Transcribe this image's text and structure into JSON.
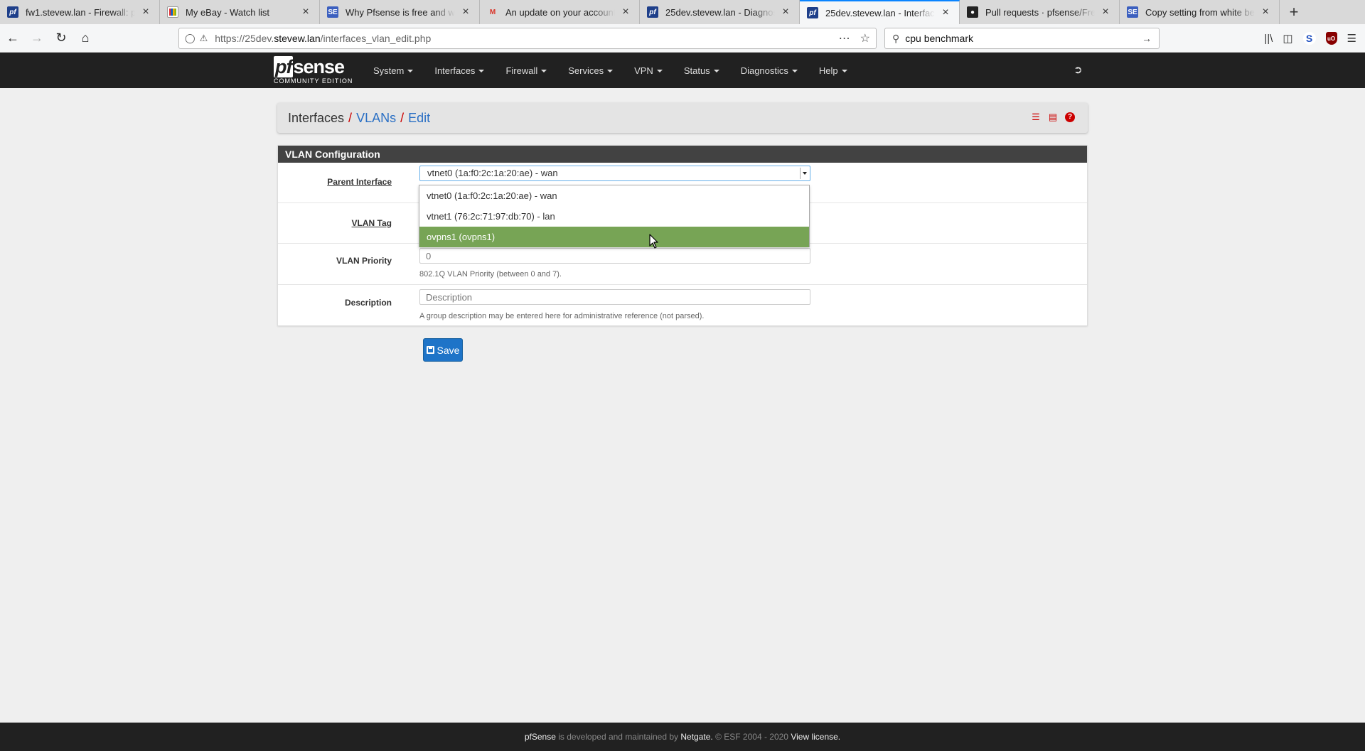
{
  "browser": {
    "tabs": [
      {
        "title": "fw1.stevew.lan - Firewall: p",
        "favicon": "pfsense-icon",
        "active": false
      },
      {
        "title": "My eBay - Watch list",
        "favicon": "ebay-icon",
        "active": false
      },
      {
        "title": "Why Pfsense is free and wh",
        "favicon": "stackexchange-icon",
        "active": false
      },
      {
        "title": "An update on your account",
        "favicon": "gmail-icon",
        "active": false
      },
      {
        "title": "25dev.stevew.lan - Diagnos",
        "favicon": "pfsense-icon",
        "active": false
      },
      {
        "title": "25dev.stevew.lan - Interfac",
        "favicon": "pfsense-icon",
        "active": true
      },
      {
        "title": "Pull requests · pfsense/Fre",
        "favicon": "github-icon",
        "active": false
      },
      {
        "title": "Copy setting from white be",
        "favicon": "stackexchange-icon",
        "active": false
      }
    ],
    "url_prefix": "https://25dev.",
    "url_domain": "stevew.lan",
    "url_path": "/interfaces_vlan_edit.php",
    "search_value": "cpu benchmark"
  },
  "pfsense": {
    "logo_text": "sense",
    "logo_pf": "pf",
    "edition": "COMMUNITY EDITION",
    "menu": [
      "System",
      "Interfaces",
      "Firewall",
      "Services",
      "VPN",
      "Status",
      "Diagnostics",
      "Help"
    ]
  },
  "breadcrumb": {
    "root": "Interfaces",
    "level2": "VLANs",
    "level3": "Edit",
    "separator": "/"
  },
  "panel": {
    "title": "VLAN Configuration",
    "parent_interface_label": "Parent Interface",
    "parent_interface_value": "vtnet0 (1a:f0:2c:1a:20:ae) - wan",
    "parent_interface_options": [
      "vtnet0 (1a:f0:2c:1a:20:ae) - wan",
      "vtnet1 (76:2c:71:97:db:70) - lan",
      "ovpns1 (ovpns1)"
    ],
    "highlighted_option_index": 2,
    "vlan_tag_label": "VLAN Tag",
    "vlan_priority_label": "VLAN Priority",
    "vlan_priority_placeholder": "0",
    "vlan_priority_help": "802.1Q VLAN Priority (between 0 and 7).",
    "description_label": "Description",
    "description_placeholder": "Description",
    "description_help": "A group description may be entered here for administrative reference (not parsed)."
  },
  "save_label": "Save",
  "footer": {
    "brand": "pfSense",
    "text1": " is developed and maintained by ",
    "company": "Netgate.",
    "text2": " © ESF 2004 - 2020 ",
    "license": "View license."
  },
  "colors": {
    "nav_bg": "#212121",
    "accent_red": "#cc0000",
    "link_blue": "#2a6fc4",
    "option_highlight": "#77a455",
    "save_blue": "#1e74c8"
  }
}
